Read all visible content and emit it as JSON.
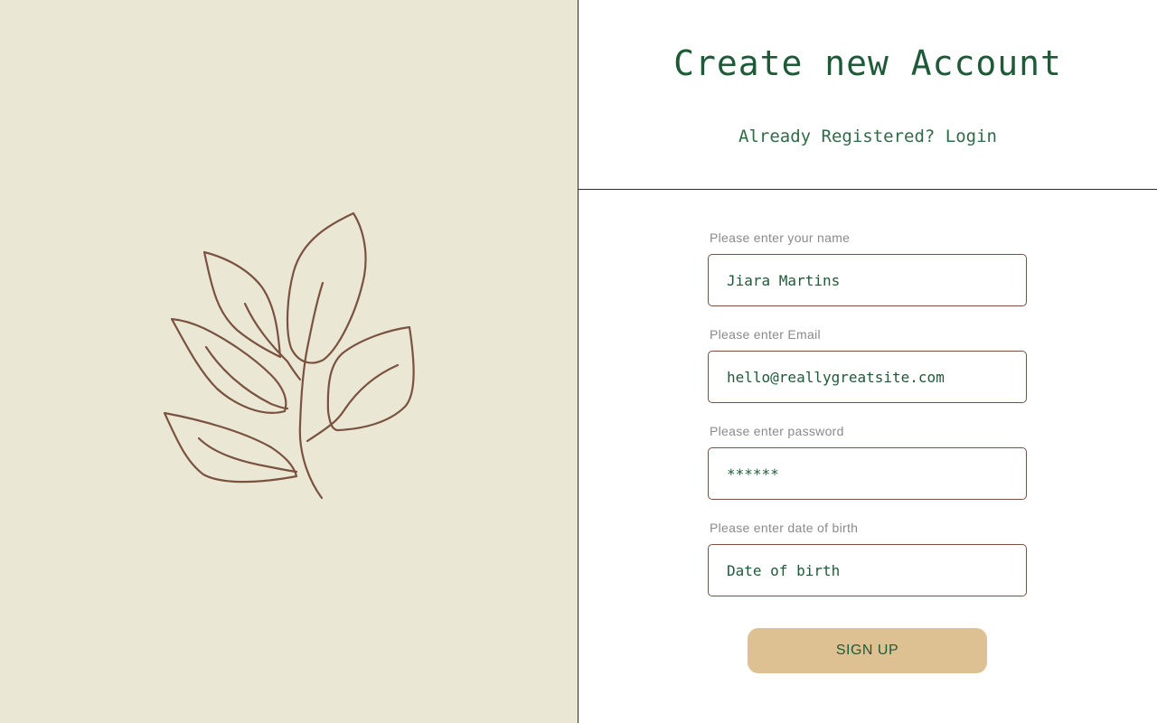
{
  "header": {
    "title": "Create new Account",
    "login_prompt": "Already Registered?",
    "login_link": "Login"
  },
  "form": {
    "name": {
      "label": "Please enter your name",
      "value": "Jiara Martins",
      "placeholder": ""
    },
    "email": {
      "label": "Please enter Email",
      "value": "hello@reallygreatsite.com",
      "placeholder": ""
    },
    "password": {
      "label": "Please enter password",
      "value": "******",
      "placeholder": ""
    },
    "dob": {
      "label": "Please enter date of birth",
      "value": "",
      "placeholder": "Date of birth"
    },
    "submit_label": "SIGN UP"
  },
  "illustration": {
    "icon": "leaf-branch-icon"
  },
  "colors": {
    "left_panel_bg": "#ebe7d5",
    "accent_green": "#1f5a38",
    "input_border": "#7a4f40",
    "button_bg": "#dec192",
    "leaf_stroke": "#7a5240"
  }
}
